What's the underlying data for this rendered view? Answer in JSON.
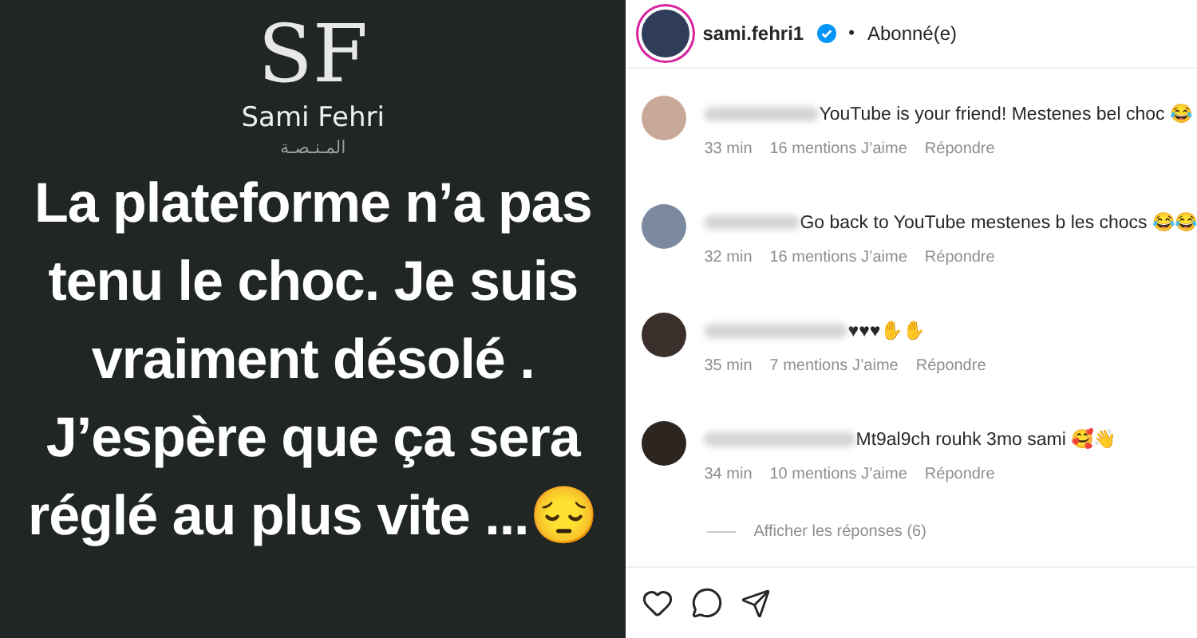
{
  "post": {
    "logo_letters": "SF",
    "brand": "Sami Fehri",
    "brand_arabic": "المـنـصـة",
    "lines": [
      "La plateforme n’a pas",
      "tenu le choc. Je suis",
      "vraiment désolé .",
      "J’espère que ça sera",
      "réglé au plus vite ...😔"
    ]
  },
  "header": {
    "username": "sami.fehri1",
    "verified": true,
    "separator": "•",
    "follow_status": "Abonné(e)"
  },
  "comments": [
    {
      "text": "YouTube is your friend! Mestenes bel choc 😂",
      "time": "33 min",
      "likes": "16 mentions J’aime",
      "reply": "Répondre"
    },
    {
      "text": "Go back to YouTube mestenes b les chocs 😂😂",
      "time": "32 min",
      "likes": "16 mentions J’aime",
      "reply": "Répondre"
    },
    {
      "text": "♥♥♥✋✋",
      "time": "35 min",
      "likes": "7 mentions J’aime",
      "reply": "Répondre"
    },
    {
      "text": "Mt9al9ch rouhk 3mo sami 🥰👋",
      "time": "34 min",
      "likes": "10 mentions J’aime",
      "reply": "Répondre",
      "replies": "Afficher les réponses (6)"
    }
  ]
}
